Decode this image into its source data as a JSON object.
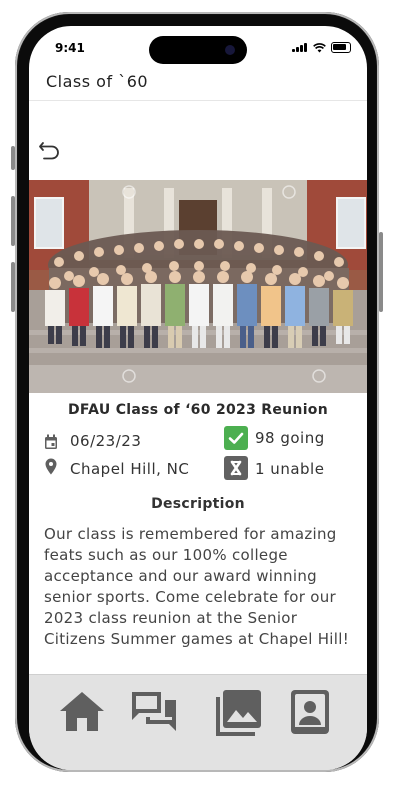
{
  "status_bar": {
    "time": "9:41"
  },
  "header": {
    "title": "Class of `60"
  },
  "event": {
    "title": "DFAU Class of ‘60 2023 Reunion",
    "date": "06/23/23",
    "location": "Chapel Hill, NC",
    "going": "98 going",
    "unable": "1 unable"
  },
  "description": {
    "heading": "Description",
    "text": "Our class is remembered for amazing feats such as our 100% college acceptance and our award winning senior sports. Come celebrate for our 2023 class reunion at the Senior Citizens Summer games at Chapel Hill!"
  },
  "tabbar": {
    "items": [
      {
        "icon": "home-icon"
      },
      {
        "icon": "chat-icon"
      },
      {
        "icon": "gallery-icon"
      },
      {
        "icon": "contact-book-icon"
      }
    ]
  },
  "colors": {
    "going_green": "#4caf50",
    "unable_gray": "#616161",
    "icon_gray": "#5f5f5f"
  }
}
